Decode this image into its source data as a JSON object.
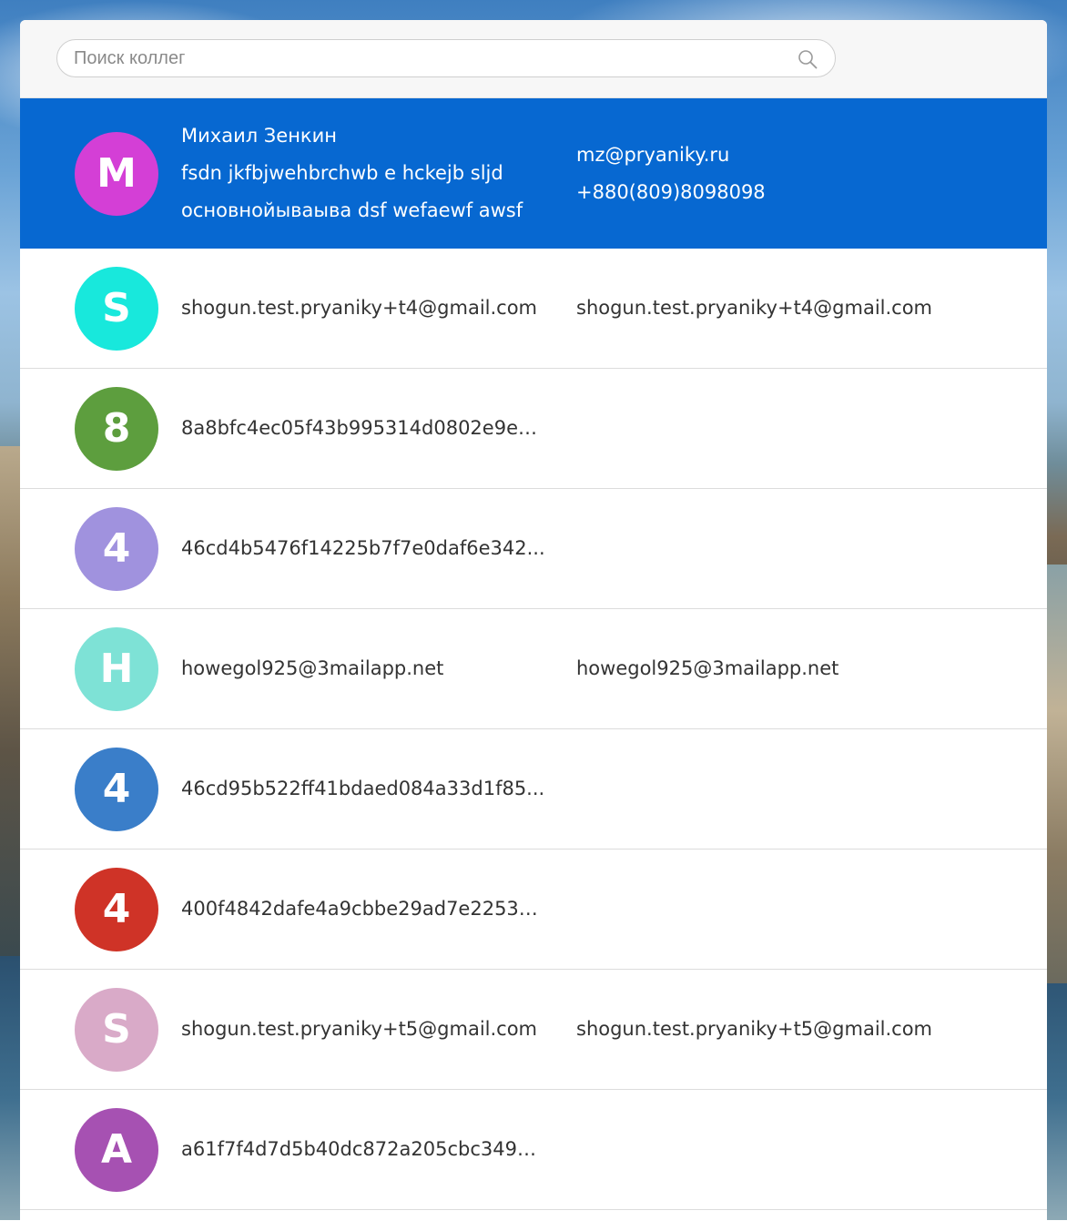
{
  "search": {
    "placeholder": "Поиск коллег",
    "icon": "search-icon"
  },
  "colors": {
    "selected_row": "#0768d1",
    "panel": "#ffffff"
  },
  "selected": {
    "avatar_letter": "M",
    "avatar_color": "#d43fd6",
    "name": "Михаил Зенкин",
    "line2": "fsdn jkfbjwehbrchwb e hckejb sljd",
    "line3": "основнойываыва dsf wefaewf awsf",
    "email": "mz@pryaniky.ru",
    "phone": "+880(809)8098098"
  },
  "people": [
    {
      "avatar_letter": "S",
      "avatar_color": "#18e8dc",
      "primary": "shogun.test.pryaniky+t4@gmail.com",
      "secondary": "shogun.test.pryaniky+t4@gmail.com"
    },
    {
      "avatar_letter": "8",
      "avatar_color": "#5d9e3e",
      "primary": "8a8bfc4ec05f43b995314d0802e9ee...",
      "secondary": ""
    },
    {
      "avatar_letter": "4",
      "avatar_color": "#a092de",
      "primary": "46cd4b5476f14225b7f7e0daf6e342...",
      "secondary": ""
    },
    {
      "avatar_letter": "H",
      "avatar_color": "#7ee2d6",
      "primary": "howegol925@3mailapp.net",
      "secondary": "howegol925@3mailapp.net"
    },
    {
      "avatar_letter": "4",
      "avatar_color": "#3a7ec9",
      "primary": "46cd95b522ff41bdaed084a33d1f85...",
      "secondary": ""
    },
    {
      "avatar_letter": "4",
      "avatar_color": "#cf3327",
      "primary": "400f4842dafe4a9cbbe29ad7e22537...",
      "secondary": ""
    },
    {
      "avatar_letter": "S",
      "avatar_color": "#d9aac8",
      "primary": "shogun.test.pryaniky+t5@gmail.com",
      "secondary": "shogun.test.pryaniky+t5@gmail.com"
    },
    {
      "avatar_letter": "A",
      "avatar_color": "#a651b2",
      "primary": "a61f7f4d7d5b40dc872a205cbc3497f...",
      "secondary": ""
    }
  ]
}
